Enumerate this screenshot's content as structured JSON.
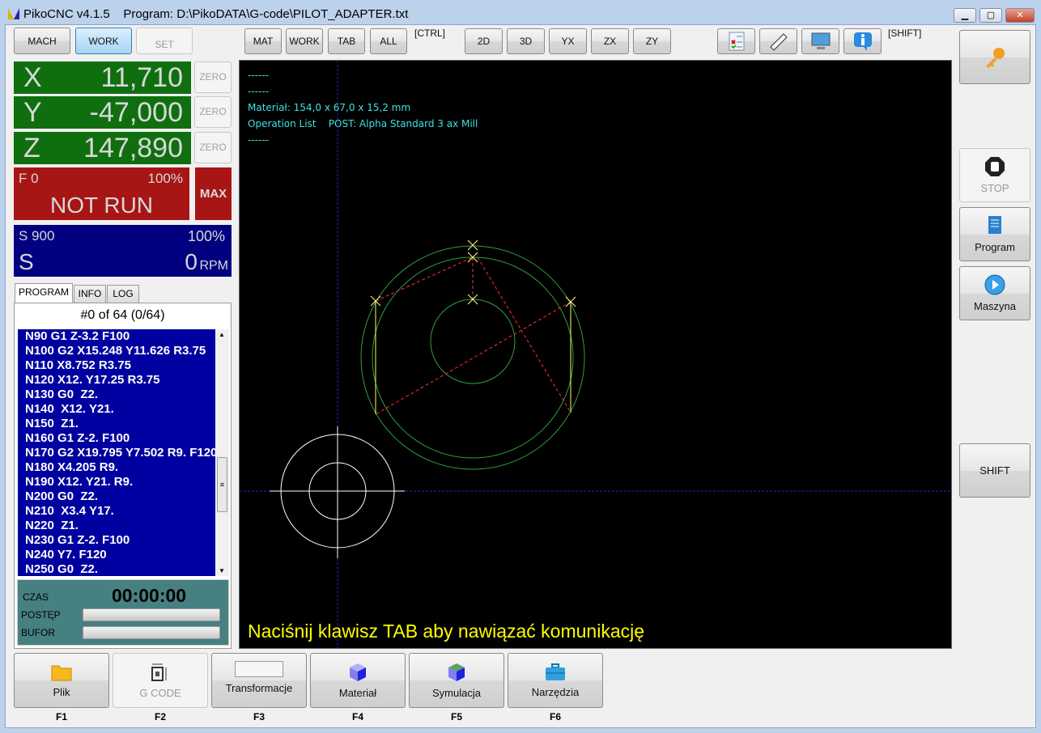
{
  "window": {
    "app": "PikoCNC v4.1.5",
    "program_label": "Program: D:\\PikoDATA\\G-code\\PILOT_ADAPTER.txt",
    "controls": [
      "minimize",
      "maximize",
      "close"
    ]
  },
  "mode_buttons": [
    {
      "label": "MACH"
    },
    {
      "label": "WORK",
      "active": true
    },
    {
      "label": "SET",
      "disabled": true
    }
  ],
  "view_buttons": {
    "group1": [
      "MAT",
      "WORK",
      "TAB",
      "ALL"
    ],
    "ctrl_hint": "[CTRL]",
    "group2": [
      "2D",
      "3D",
      "YX",
      "ZX",
      "ZY"
    ],
    "shift_hint": "[SHIFT]",
    "icons": [
      "checklist-icon",
      "ruler-icon",
      "monitor-icon",
      "info-icon"
    ]
  },
  "coords": [
    {
      "axis": "X",
      "value": "11,710",
      "zero": "ZERO"
    },
    {
      "axis": "Y",
      "value": "-47,000",
      "zero": "ZERO"
    },
    {
      "axis": "Z",
      "value": "147,890",
      "zero": "ZERO"
    }
  ],
  "feed": {
    "label": "F 0",
    "percent": "100%",
    "status": "NOT RUN",
    "max": "MAX"
  },
  "spindle": {
    "label": "S 900",
    "percent": "100%",
    "axis": "S",
    "value": "0",
    "unit": "RPM"
  },
  "tabs": [
    "PROGRAM",
    "INFO",
    "LOG"
  ],
  "program": {
    "position": "#0 of 64 (0/64)",
    "lines": [
      "N90 G1 Z-3.2 F100",
      "N100 G2 X15.248 Y11.626 R3.75",
      "N110 X8.752 R3.75",
      "N120 X12. Y17.25 R3.75",
      "N130 G0  Z2.",
      "N140  X12. Y21.",
      "N150  Z1.",
      "N160 G1 Z-2. F100",
      "N170 G2 X19.795 Y7.502 R9. F120",
      "N180 X4.205 R9.",
      "N190 X12. Y21. R9.",
      "N200 G0  Z2.",
      "N210  X3.4 Y17.",
      "N220  Z1.",
      "N230 G1 Z-2. F100",
      "N240 Y7. F120",
      "N250 G0  Z2."
    ]
  },
  "status": {
    "time_label": "CZAS",
    "time": "00:00:00",
    "progress_label": "POSTĘP",
    "progress": 0,
    "buffer_label": "BUFOR",
    "buffer": 0
  },
  "viewport": {
    "info": [
      "------",
      "------",
      "Materiał: 154,0 x 67,0 x 15,2 mm",
      "Operation List    POST: Alpha Standard 3 ax Mill",
      "------"
    ],
    "message": "Naciśnij klawisz TAB aby nawiązać komunikację",
    "colors": {
      "background": "#000000",
      "info_text": "#40e0e0",
      "message": "#ffff00",
      "toolpath": "#ffff60",
      "rapid": "#ff3030",
      "material": "#30a040",
      "tool": "#ffffff",
      "axes": "#2020c0"
    }
  },
  "right_buttons": [
    {
      "label": "",
      "icon": "key-icon"
    },
    {
      "label": "STOP",
      "icon": "stop-hand-icon",
      "disabled": true
    },
    {
      "label": "Program",
      "icon": "scroll-icon"
    },
    {
      "label": "Maszyna",
      "icon": "play-circle-icon"
    },
    {
      "label": "SHIFT"
    }
  ],
  "function_buttons": [
    {
      "label": "Plik",
      "key": "F1",
      "icon": "folder-icon"
    },
    {
      "label": "G CODE",
      "key": "F2",
      "icon": "resize-icon",
      "disabled": true
    },
    {
      "label": "Transformacje",
      "key": "F3",
      "icon": "blank-icon"
    },
    {
      "label": "Materiał",
      "key": "F4",
      "icon": "cube-icon"
    },
    {
      "label": "Symulacja",
      "key": "F5",
      "icon": "simulation-cube-icon"
    },
    {
      "label": "Narzędzia",
      "key": "F6",
      "icon": "toolbox-icon"
    }
  ]
}
